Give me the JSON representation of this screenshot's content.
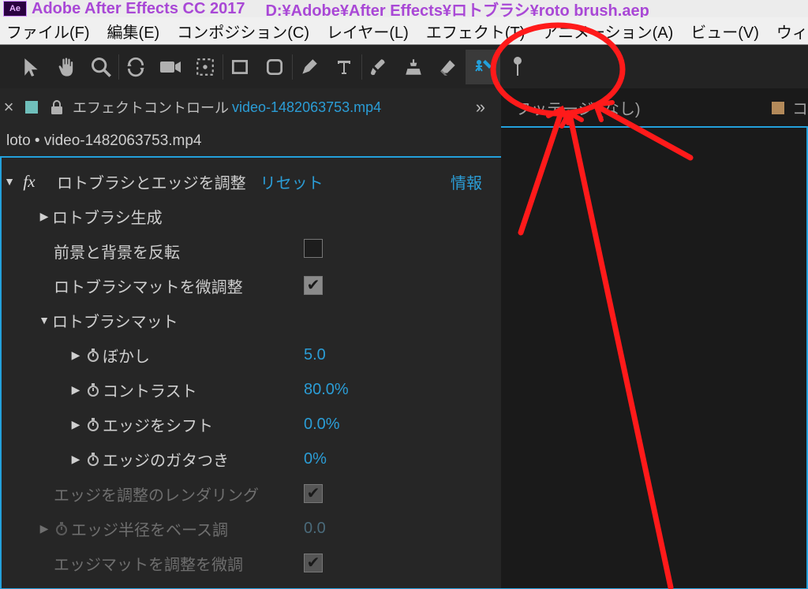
{
  "titlebar": {
    "badge": "Ae",
    "app_name": "Adobe After Effects CC 2017",
    "doc_path": "D:¥Adobe¥After Effects¥ロトブラシ¥roto brush.aep"
  },
  "menu": {
    "file": "ファイル(F)",
    "edit": "編集(E)",
    "composition": "コンポジション(C)",
    "layer": "レイヤー(L)",
    "effect": "エフェクト(T)",
    "animation": "アニメーション(A)",
    "view": "ビュー(V)",
    "window": "ウィ"
  },
  "tools": {
    "selection": "selection",
    "hand": "hand",
    "zoom": "zoom",
    "orbit": "orbit",
    "camera": "camera",
    "region": "region",
    "mask_rect": "mask_rect",
    "mask_ellipse": "mask_ellipse",
    "pen": "pen",
    "type": "type",
    "brush": "brush",
    "clone": "clone",
    "eraser": "eraser",
    "roto": "roto",
    "pin": "pin"
  },
  "ec": {
    "close": "×",
    "panel_label": "エフェクトコントロール",
    "file": "video-1482063753.mp4",
    "more": "»",
    "comp_line": "loto • video-1482063753.mp4"
  },
  "roto": {
    "effect_name": "ロトブラシとエッジを調整",
    "reset": "リセット",
    "info": "情報",
    "gen": "ロトブラシ生成",
    "invert_label": "前景と背景を反転",
    "invert_on": false,
    "fine_label": "ロトブラシマットを微調整",
    "fine_on": true,
    "matte_group": "ロトブラシマット",
    "feather_label": "ぼかし",
    "feather_value": "5.0",
    "contrast_label": "コントラスト",
    "contrast_value": "80.0%",
    "shift_label": "エッジをシフト",
    "shift_value": "0.0%",
    "chatter_label": "エッジのガタつき",
    "chatter_value": "0%",
    "render_label": "エッジを調整のレンダリング",
    "render_on": true,
    "radius_label": "エッジ半径をベース調",
    "radius_value": "0.0",
    "edge_matte_label": "エッジマットを調整を微調"
  },
  "right": {
    "footage_label": "フッテージ (なし)",
    "comp_label_short": "コ"
  },
  "colors": {
    "accent": "#23a0db",
    "link": "#2b9dd6",
    "annotation": "#ff1a1a"
  }
}
